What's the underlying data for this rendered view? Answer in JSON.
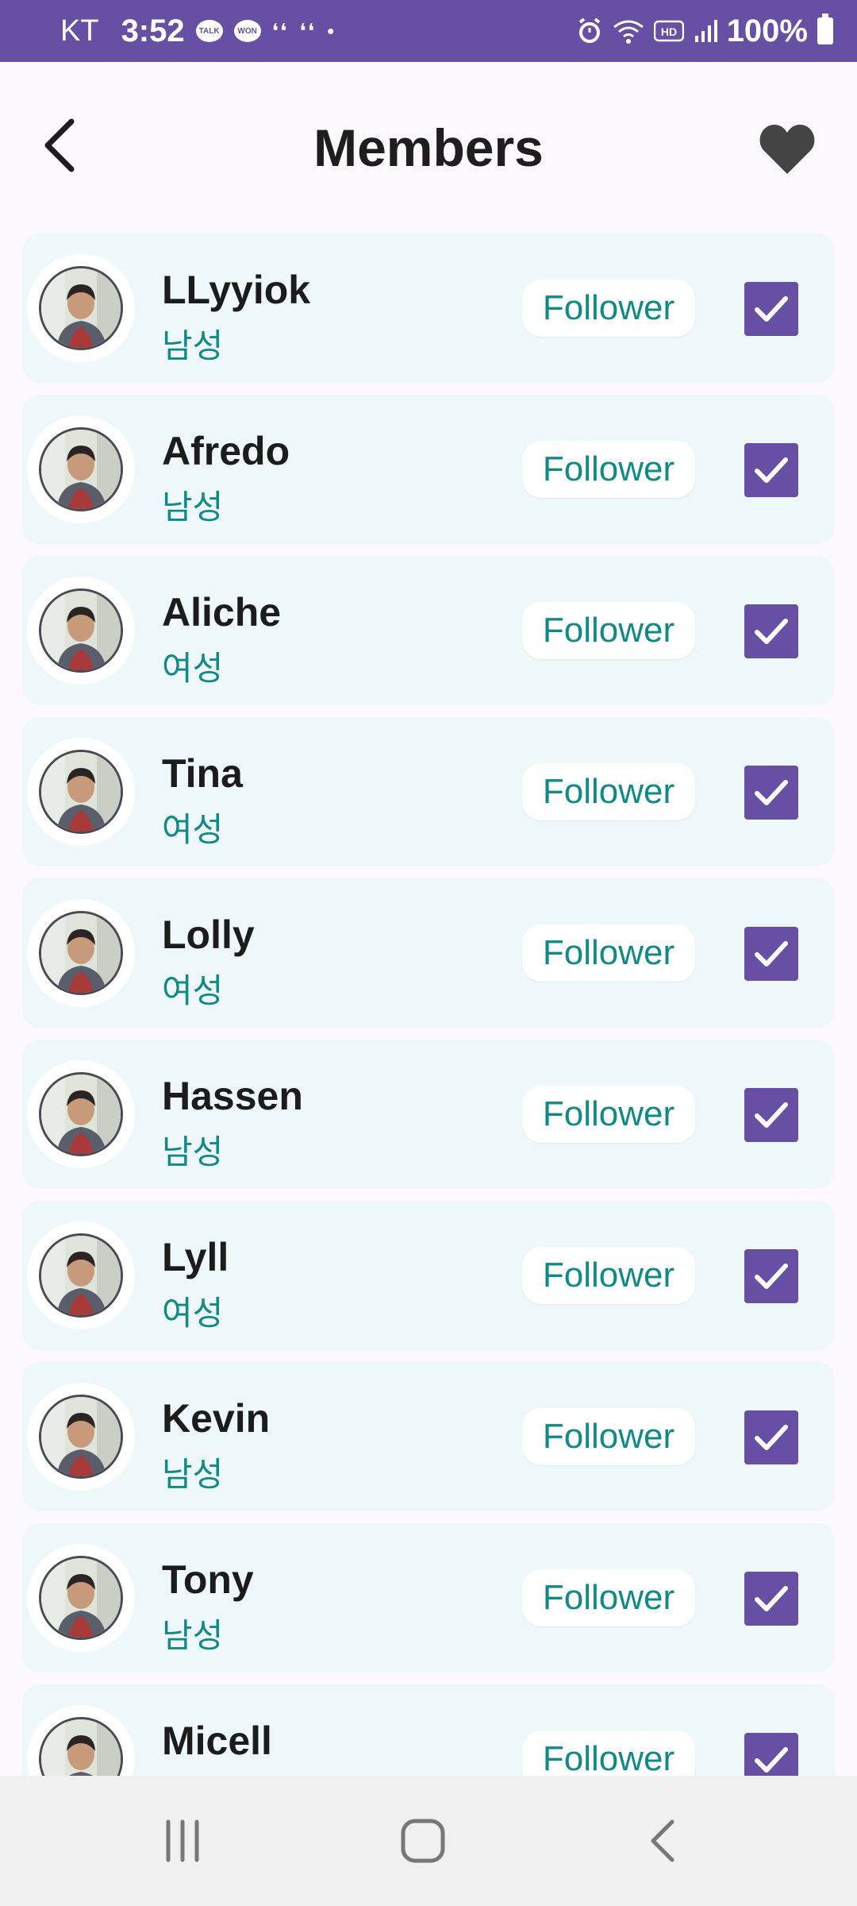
{
  "status_bar": {
    "carrier": "KT",
    "time": "3:52",
    "talk_label": "TALK",
    "won_label": "WON",
    "battery": "100%"
  },
  "header": {
    "title": "Members"
  },
  "members": [
    {
      "name": "LLyyiok",
      "gender": "남성",
      "follow_label": "Follower",
      "checked": true
    },
    {
      "name": "Afredo",
      "gender": "남성",
      "follow_label": "Follower",
      "checked": true
    },
    {
      "name": "Aliche",
      "gender": "여성",
      "follow_label": "Follower",
      "checked": true
    },
    {
      "name": "Tina",
      "gender": "여성",
      "follow_label": "Follower",
      "checked": true
    },
    {
      "name": "Lolly",
      "gender": "여성",
      "follow_label": "Follower",
      "checked": true
    },
    {
      "name": "Hassen",
      "gender": "남성",
      "follow_label": "Follower",
      "checked": true
    },
    {
      "name": "Lyll",
      "gender": "여성",
      "follow_label": "Follower",
      "checked": true
    },
    {
      "name": "Kevin",
      "gender": "남성",
      "follow_label": "Follower",
      "checked": true
    },
    {
      "name": "Tony",
      "gender": "남성",
      "follow_label": "Follower",
      "checked": true
    },
    {
      "name": "Micell",
      "gender": "",
      "follow_label": "Follower",
      "checked": true
    }
  ],
  "colors": {
    "accent": "#6750a4",
    "teal": "#118a86",
    "card_bg": "#eef8fb"
  },
  "icons": {
    "back": "chevron-left-icon",
    "favorite": "heart-icon",
    "nav_recent": "recent-apps-icon",
    "nav_home": "home-icon",
    "nav_back": "back-icon"
  }
}
